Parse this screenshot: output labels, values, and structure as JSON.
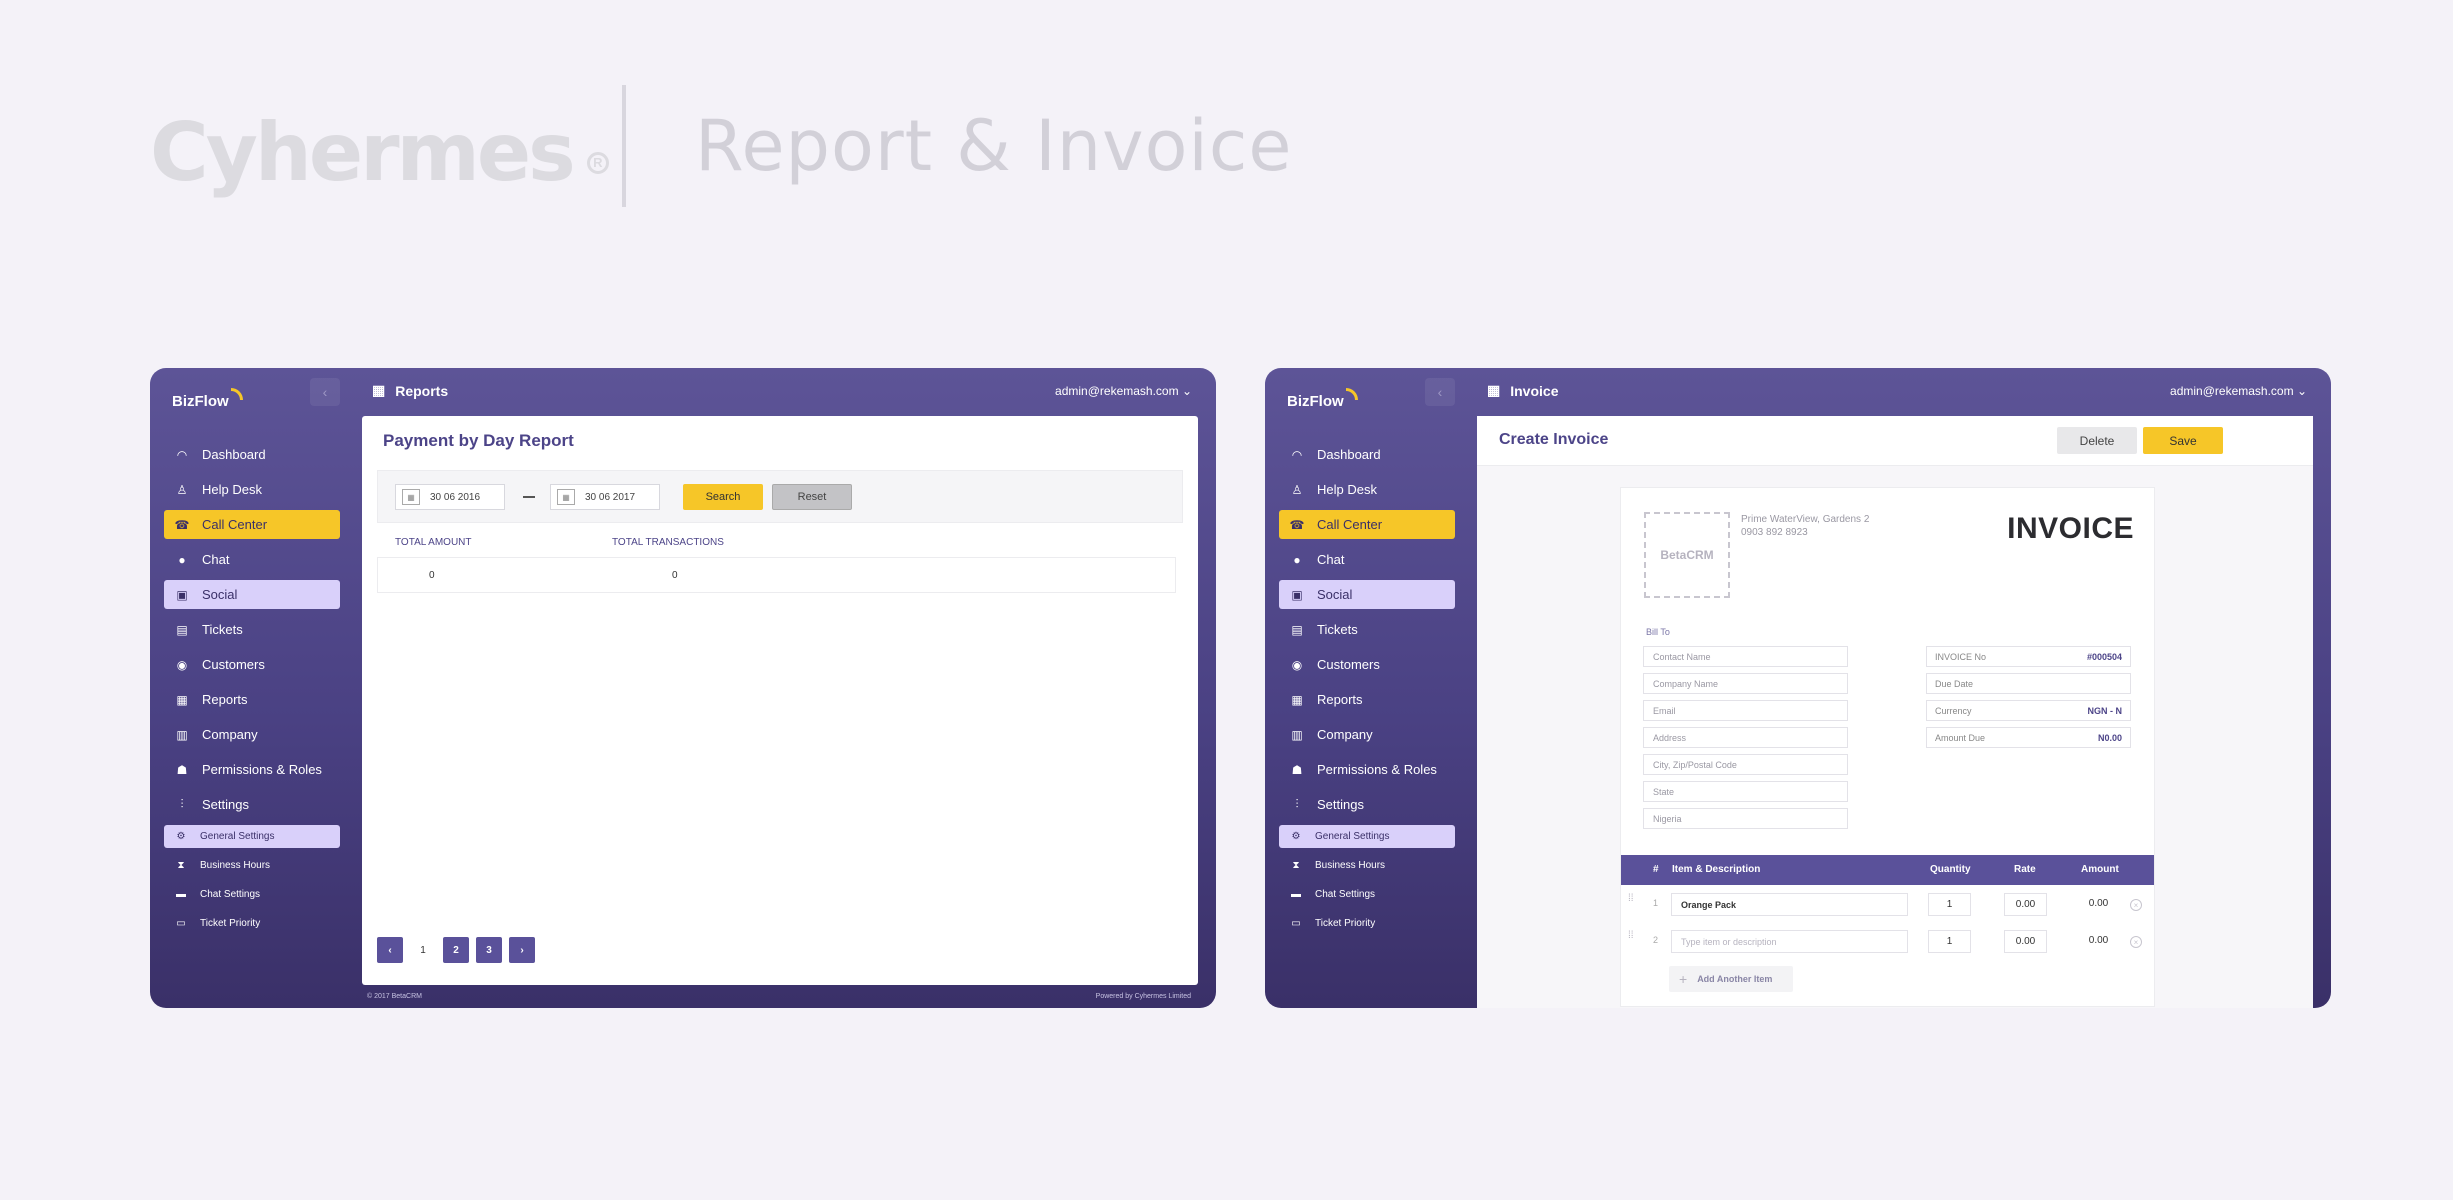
{
  "header": {
    "brand": "Cyhermes",
    "brand_mark": "R",
    "title": "Report & Invoice"
  },
  "app": {
    "logo": "BizFlow",
    "user": "admin@rekemash.com",
    "collapse_icon": "chevron-left-icon",
    "nav": [
      {
        "label": "Dashboard",
        "icon": "gauge-icon",
        "glyph": "◠"
      },
      {
        "label": "Help Desk",
        "icon": "person-icon",
        "glyph": "♙"
      },
      {
        "label": "Call Center",
        "icon": "call-center-icon",
        "glyph": "☎"
      },
      {
        "label": "Chat",
        "icon": "chat-bubble-icon",
        "glyph": "●"
      },
      {
        "label": "Social",
        "icon": "social-screen-icon",
        "glyph": "▣"
      },
      {
        "label": "Tickets",
        "icon": "ticket-icon",
        "glyph": "▤"
      },
      {
        "label": "Customers",
        "icon": "customer-icon",
        "glyph": "◉"
      },
      {
        "label": "Reports",
        "icon": "reports-icon",
        "glyph": "▦"
      },
      {
        "label": "Company",
        "icon": "building-icon",
        "glyph": "▥"
      },
      {
        "label": "Permissions & Roles",
        "icon": "permissions-icon",
        "glyph": "☗"
      },
      {
        "label": "Settings",
        "icon": "sliders-icon",
        "glyph": "⫶"
      }
    ],
    "subnav": [
      {
        "label": "General Settings",
        "icon": "gear-icon",
        "glyph": "⚙"
      },
      {
        "label": "Business Hours",
        "icon": "hourglass-icon",
        "glyph": "⧗"
      },
      {
        "label": "Chat Settings",
        "icon": "chat-settings-icon",
        "glyph": "▬"
      },
      {
        "label": "Ticket Priority",
        "icon": "ticket-priority-icon",
        "glyph": "▭"
      }
    ]
  },
  "report": {
    "section": "Reports",
    "title": "Payment by Day Report",
    "date_from": "30 06 2016",
    "date_to": "30 06 2017",
    "search_label": "Search",
    "reset_label": "Reset",
    "columns": [
      "TOTAL AMOUNT",
      "TOTAL TRANSACTIONS"
    ],
    "row": [
      "0",
      "0"
    ],
    "pages": [
      "1",
      "2",
      "3"
    ],
    "footer_left": "© 2017 BetaCRM",
    "footer_right": "Powered by Cyhermes Limited"
  },
  "invoice": {
    "section": "Invoice",
    "title": "Create Invoice",
    "delete_label": "Delete",
    "save_label": "Save",
    "logo_placeholder": "BetaCRM",
    "address_line1": "Prime WaterView, Gardens 2",
    "address_line2": "0903 892 8923",
    "heading": "INVOICE",
    "bill_to": "Bill To",
    "fields": [
      "Contact Name",
      "Company Name",
      "Email",
      "Address",
      "City, Zip/Postal Code",
      "State",
      "Nigeria"
    ],
    "meta": [
      {
        "label": "INVOICE No",
        "value": "#000504"
      },
      {
        "label": "Due Date",
        "value": ""
      },
      {
        "label": "Currency",
        "value": "NGN - N"
      },
      {
        "label": "Amount Due",
        "value": "N0.00"
      }
    ],
    "columns": {
      "num": "#",
      "item": "Item & Description",
      "qty": "Quantity",
      "rate": "Rate",
      "amount": "Amount"
    },
    "items": [
      {
        "num": "1",
        "desc": "Orange Pack",
        "qty": "1",
        "rate": "0.00",
        "amount": "0.00"
      },
      {
        "num": "2",
        "desc": "",
        "placeholder": "Type item or description",
        "qty": "1",
        "rate": "0.00",
        "amount": "0.00"
      }
    ],
    "add_item_label": "Add Another Item"
  },
  "colors": {
    "primary": "#4a4183",
    "accent_yellow": "#f6c628",
    "active_lilac": "#d9d0fa"
  }
}
